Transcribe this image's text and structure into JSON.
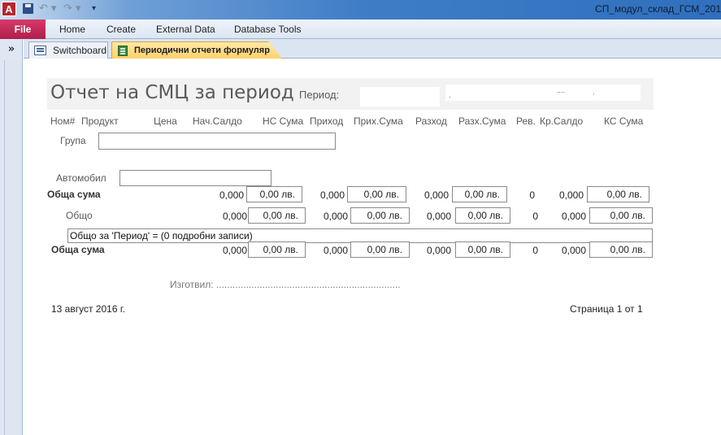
{
  "app": {
    "icon_letter": "A",
    "title": "СП_модул_склад_ГСМ_201"
  },
  "qat": {
    "undo_glyph": "↶ ▾",
    "redo_glyph": "↷ ▾",
    "customize_glyph": "▾"
  },
  "ribbon": {
    "file": "File",
    "tabs": [
      "Home",
      "Create",
      "External Data",
      "Database Tools"
    ]
  },
  "nav": {
    "toggle": "»"
  },
  "doc_tabs": [
    {
      "label": "Switchboard",
      "icon": "form-icon",
      "active": false
    },
    {
      "label": "Периодични отчети формуляр",
      "icon": "report-icon",
      "active": true
    }
  ],
  "report": {
    "title": "Отчет на СМЦ за период",
    "period_label": "Период:",
    "period_to_dots": [
      ".",
      "....",
      "."
    ],
    "columns": [
      "Ном#",
      "Продукт",
      "Цена",
      "Нач.Салдо",
      "НС Сума",
      "Приход",
      "Прих.Сума",
      "Разход",
      "Разх.Сума",
      "Рев.",
      "Кр.Салдо",
      "КС Сума"
    ],
    "group_label": "Група",
    "vehicle_label": "Автомобил",
    "rows": [
      {
        "label": "Обща сума",
        "values": [
          "0,000",
          "0,00 лв.",
          "0,000",
          "0,00 лв.",
          "0,000",
          "0,00 лв.",
          "0",
          "0,000",
          "0,00 лв."
        ]
      },
      {
        "label": "Общо",
        "values": [
          "0,000",
          "0,00 лв.",
          "0,000",
          "0,00 лв.",
          "0,000",
          "0,00 лв.",
          "0",
          "0,000",
          "0,00 лв."
        ]
      },
      {
        "label": "Обща сума",
        "values": [
          "0,000",
          "0,00 лв.",
          "0,000",
          "0,00 лв.",
          "0,000",
          "0,00 лв.",
          "0",
          "0,000",
          "0,00 лв."
        ]
      }
    ],
    "summary_line": "Общо за 'Период' =   (0 подробни записи)",
    "made_by": "Изготвил: ....................................................................",
    "date": "13 август 2016 г.",
    "page": "Страница 1 от 1"
  },
  "colors": {
    "file_tab": "#c4285a",
    "active_tab": "#ffd06a",
    "header_band": "#f2f2f2",
    "label_gray": "#595959"
  }
}
